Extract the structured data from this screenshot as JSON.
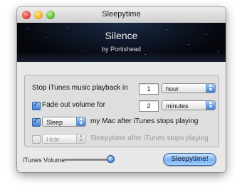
{
  "window": {
    "title": "Sleepytime"
  },
  "now_playing": {
    "track": "Silence",
    "artist": "by Portishead"
  },
  "stop_row": {
    "label": "Stop iTunes music playback in",
    "value": "1",
    "unit": "hour"
  },
  "fade_row": {
    "checked": true,
    "label": "Fade out volume for",
    "value": "2",
    "unit": "minutes"
  },
  "sleep_row": {
    "checked": true,
    "action": "Sleep",
    "label": "my Mac after iTunes stops playing"
  },
  "hide_row": {
    "checked": false,
    "enabled": false,
    "action": "Hide",
    "label": "Sleepytime after iTunes stops playing"
  },
  "volume": {
    "label": "iTunes Volume:",
    "level_fraction": 0.92
  },
  "go_button": {
    "label": "Sleepytime!"
  },
  "colors": {
    "accent": "#4b8de0",
    "banner": "#05070d"
  }
}
